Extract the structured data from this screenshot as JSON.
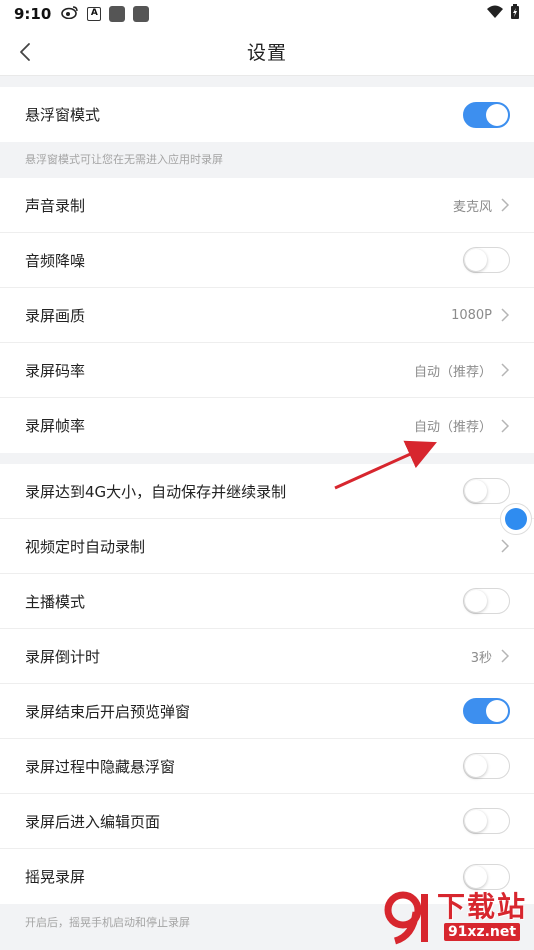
{
  "status_bar": {
    "time": "9:10",
    "a_badge": "A"
  },
  "header": {
    "title": "设置"
  },
  "section1": {
    "floating_mode": {
      "label": "悬浮窗模式",
      "on": true
    }
  },
  "hint1": "悬浮窗模式可让您在无需进入应用时录屏",
  "section2": {
    "audio_record": {
      "label": "声音录制",
      "value": "麦克风"
    },
    "noise_reduction": {
      "label": "音频降噪",
      "on": false
    },
    "quality": {
      "label": "录屏画质",
      "value": "1080P"
    },
    "bitrate": {
      "label": "录屏码率",
      "value": "自动（推荐）"
    },
    "framerate": {
      "label": "录屏帧率",
      "value": "自动（推荐）"
    }
  },
  "section3": {
    "auto_save_4g": {
      "label": "录屏达到4G大小，自动保存并继续录制",
      "on": false
    },
    "scheduled": {
      "label": "视频定时自动录制"
    },
    "streamer": {
      "label": "主播模式",
      "on": false
    },
    "countdown": {
      "label": "录屏倒计时",
      "value": "3秒"
    },
    "preview_popup": {
      "label": "录屏结束后开启预览弹窗",
      "on": true
    },
    "hide_float": {
      "label": "录屏过程中隐藏悬浮窗",
      "on": false
    },
    "enter_editor": {
      "label": "录屏后进入编辑页面",
      "on": false
    },
    "shake": {
      "label": "摇晃录屏",
      "on": false
    }
  },
  "hint2": "开启后，摇晃手机启动和停止录屏",
  "watermark": {
    "brand": "下载站",
    "url": "91xz.net"
  },
  "colors": {
    "accent": "#3d8fef",
    "arrow": "#d7262e",
    "watermark_red": "#d7262e"
  }
}
